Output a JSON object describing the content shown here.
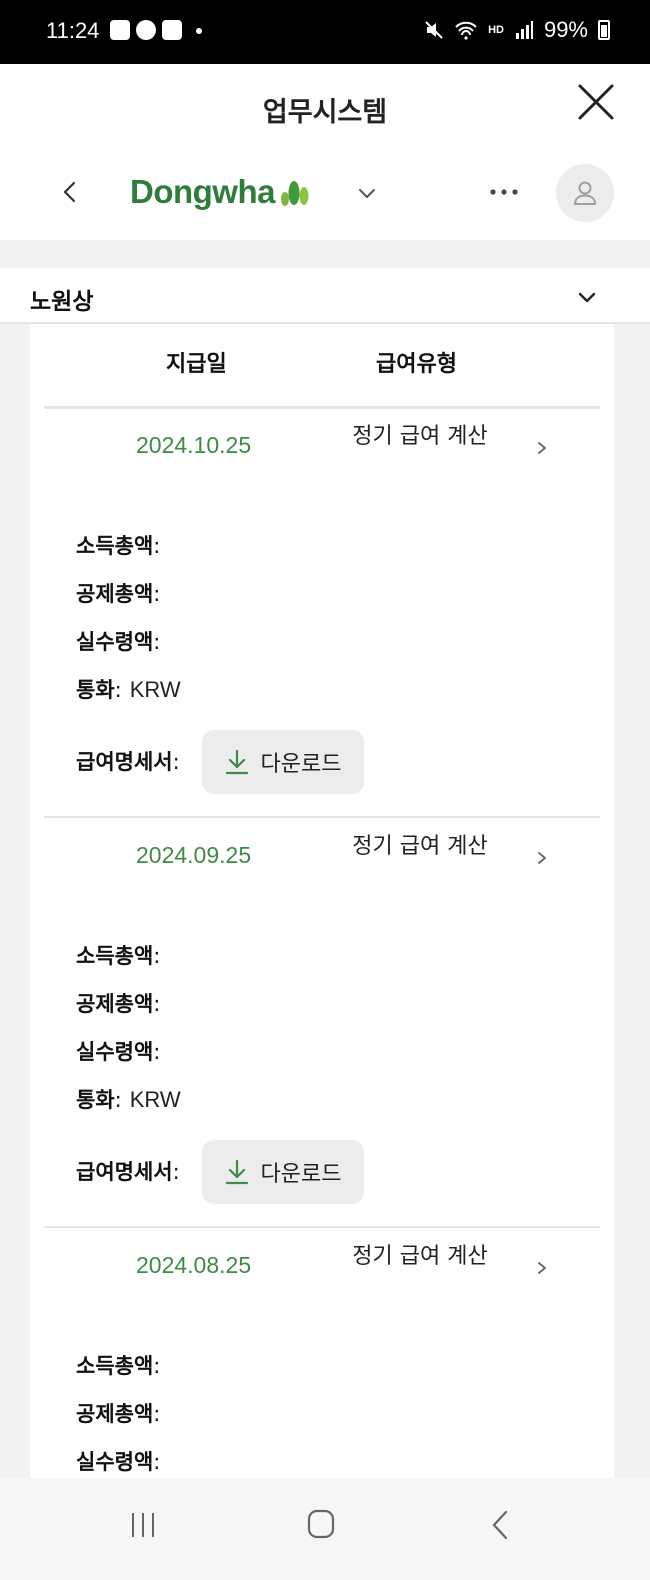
{
  "status_bar": {
    "time": "11:24",
    "battery": "99%",
    "network": "HD"
  },
  "header": {
    "title": "업무시스템"
  },
  "nav": {
    "brand": "Dongwha",
    "brand_color": "#2f7d3a"
  },
  "section": {
    "name": "노원상"
  },
  "table": {
    "columns": [
      "지급일",
      "급여유형"
    ]
  },
  "labels": {
    "gross": "소득총액",
    "deduction": "공제총액",
    "net": "실수령액",
    "currency": "통화",
    "payslip": "급여명세서",
    "colon": ":",
    "download": "다운로드"
  },
  "records": [
    {
      "date": "2024.10.25",
      "type": "정기 급여 계산",
      "currency": "KRW"
    },
    {
      "date": "2024.09.25",
      "type": "정기 급여 계산",
      "currency": "KRW"
    },
    {
      "date": "2024.08.25",
      "type": "정기 급여 계산"
    }
  ],
  "colors": {
    "accent_green": "#3f8a48",
    "button_bg": "#ececec"
  }
}
